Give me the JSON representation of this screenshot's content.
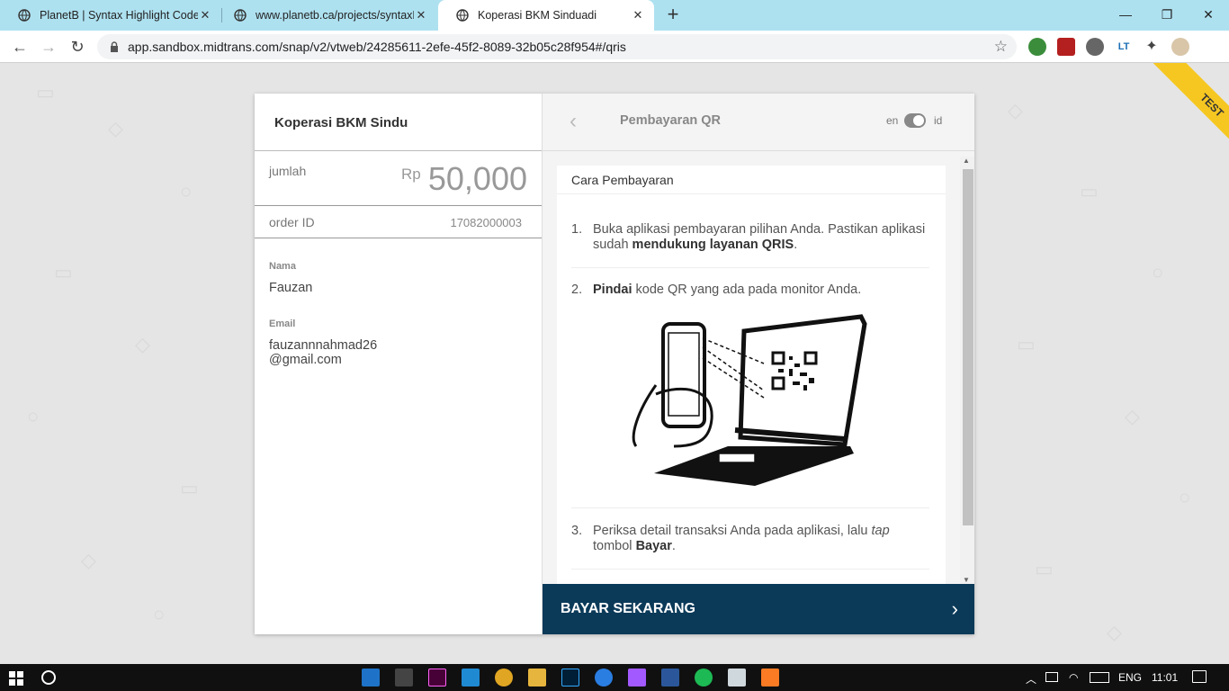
{
  "browser": {
    "tabs": [
      {
        "title": "PlanetB | Syntax Highlight Code i",
        "active": false
      },
      {
        "title": "www.planetb.ca/projects/syntaxH",
        "active": false
      },
      {
        "title": "Koperasi BKM Sinduadi",
        "active": true
      }
    ],
    "url": "app.sandbox.midtrans.com/snap/v2/vtweb/24285611-2efe-45f2-8089-32b05c28f954#/qris",
    "icons": [
      "back-icon",
      "forward-icon",
      "reload-icon",
      "lock-icon",
      "star-icon",
      "extension-icon",
      "profile-icon"
    ]
  },
  "ribbon": {
    "label": "TEST"
  },
  "snap": {
    "merchant_name": "Koperasi BKM Sindu",
    "amount_label": "jumlah",
    "currency": "Rp",
    "amount": "50,000",
    "order_label": "order ID",
    "order_id": "17082000003",
    "customer": {
      "name_label": "Nama",
      "name": "Fauzan",
      "email_label": "Email",
      "email_line1": "fauzannnahmad26",
      "email_line2": "@gmail.com"
    },
    "header": {
      "title": "Pembayaran QR",
      "lang_en": "en",
      "lang_id": "id"
    },
    "instructions": {
      "title": "Cara Pembayaran",
      "steps": [
        {
          "num": "1.",
          "pre": "Buka aplikasi pembayaran pilihan Anda. Pastikan aplikasi sudah ",
          "bold": "mendukung layanan QRIS",
          "post": "."
        },
        {
          "num": "2.",
          "bold": "Pindai",
          "post": " kode QR yang ada pada monitor Anda."
        },
        {
          "num": "3.",
          "pre": "Periksa detail transaksi Anda pada aplikasi, lalu ",
          "italic": "tap",
          "mid": " tombol ",
          "bold": "Bayar",
          "post": "."
        }
      ]
    },
    "pay_button": "BAYAR SEKARANG"
  },
  "taskbar": {
    "language": "ENG",
    "time": "11:01"
  }
}
